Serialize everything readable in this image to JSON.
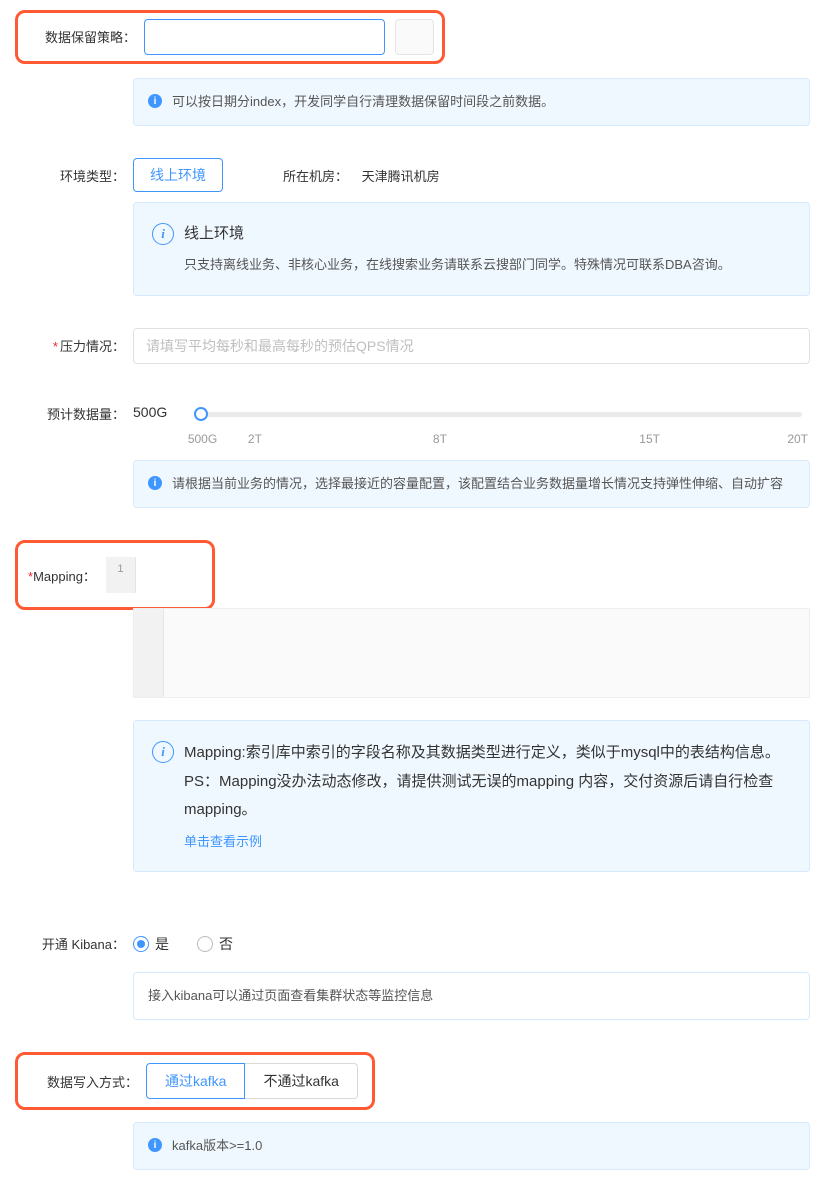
{
  "retention": {
    "label": "数据保留策略：",
    "info": "可以按日期分index，开发同学自行清理数据保留时间段之前数据。"
  },
  "env": {
    "label": "环境类型：",
    "selected": "线上环境",
    "room_label": "所在机房：",
    "room_value": "天津腾讯机房",
    "box_title": "线上环境",
    "box_body": "只支持离线业务、非核心业务，在线搜索业务请联系云搜部门同学。特殊情况可联系DBA咨询。"
  },
  "pressure": {
    "label": "压力情况：",
    "placeholder": "请填写平均每秒和最高每秒的预估QPS情况"
  },
  "volume": {
    "label": "预计数据量：",
    "value": "500G",
    "marks": [
      "500G",
      "2T",
      "8T",
      "15T",
      "20T"
    ],
    "info": "请根据当前业务的情况，选择最接近的容量配置，该配置结合业务数据量增长情况支持弹性伸缩、自动扩容"
  },
  "mapping": {
    "label": "Mapping：",
    "gutter_line": "1",
    "box_body": "Mapping:索引库中索引的字段名称及其数据类型进行定义，类似于mysql中的表结构信息。PS：Mapping没办法动态修改，请提供测试无误的mapping 内容，交付资源后请自行检查 mapping。",
    "link": "单击查看示例"
  },
  "kibana": {
    "label": "开通 Kibana：",
    "options": {
      "yes": "是",
      "no": "否"
    },
    "selected": "yes",
    "info": "接入kibana可以通过页面查看集群状态等监控信息"
  },
  "write_mode": {
    "label": "数据写入方式：",
    "options": {
      "kafka": "通过kafka",
      "no_kafka": "不通过kafka"
    },
    "selected": "kafka",
    "info": "kafka版本>=1.0"
  }
}
